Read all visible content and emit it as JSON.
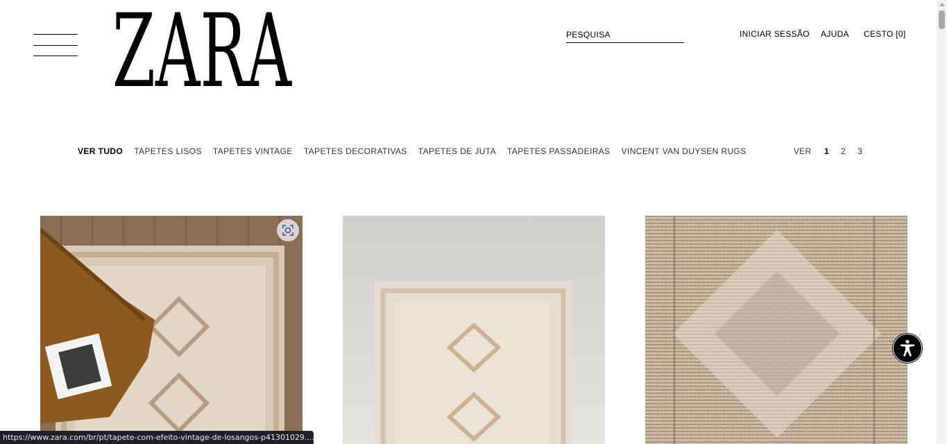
{
  "header": {
    "logo": "ZARA",
    "search_label": "PESQUISA",
    "login": "INICIAR SESSÃO",
    "help": "AJUDA",
    "cart": "CESTO [0]"
  },
  "categories": [
    {
      "label": "VER TUDO",
      "active": true
    },
    {
      "label": "TAPETES LISOS"
    },
    {
      "label": "TAPETES VINTAGE"
    },
    {
      "label": "TAPETES DECORATIVAS"
    },
    {
      "label": "TAPETES DE JUTA"
    },
    {
      "label": "TAPETES PASSADEIRAS"
    },
    {
      "label": "VINCENT VAN DUYSEN RUGS"
    }
  ],
  "view": {
    "label": "VER",
    "options": [
      "1",
      "2",
      "3"
    ],
    "selected": "1"
  },
  "products": [
    {
      "image": "vintage-rug-on-wood-floor"
    },
    {
      "image": "vintage-rug-top-view"
    },
    {
      "image": "rug-texture-closeup"
    }
  ],
  "status_url": "https://www.zara.com/br/pt/tapete-com-efeito-vintage-de-losangos-p41301029....",
  "icons": {
    "menu": "hamburger-menu-icon",
    "scan": "visual-search-icon",
    "accessibility": "accessibility-icon"
  },
  "colors": {
    "accent": "#000000",
    "scan_icon": "#3b6ea8"
  }
}
